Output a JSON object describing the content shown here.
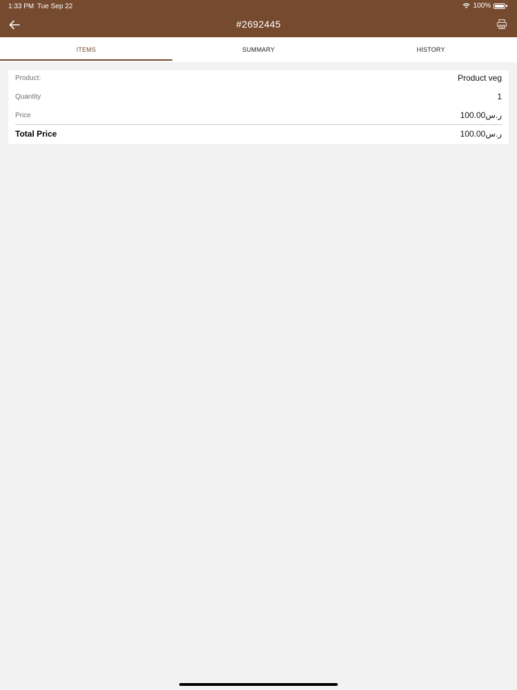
{
  "status_bar": {
    "time": "1:33 PM",
    "date": "Tue Sep 22",
    "battery": "100%"
  },
  "header": {
    "title": "#2692445",
    "back_icon": "arrow-left-icon",
    "print_icon": "printer-icon"
  },
  "tabs": [
    {
      "label": "ITEMS",
      "active": true
    },
    {
      "label": "SUMMARY",
      "active": false
    },
    {
      "label": "HISTORY",
      "active": false
    }
  ],
  "item": {
    "product_label": "Product:",
    "product_value": "Product veg",
    "quantity_label": "Quantity",
    "quantity_value": "1",
    "price_label": "Price",
    "price_value": "100.00ر.س",
    "total_label": "Total Price",
    "total_value": "100.00ر.س"
  },
  "colors": {
    "brand": "#754a2f",
    "background": "#f2f2f3"
  }
}
